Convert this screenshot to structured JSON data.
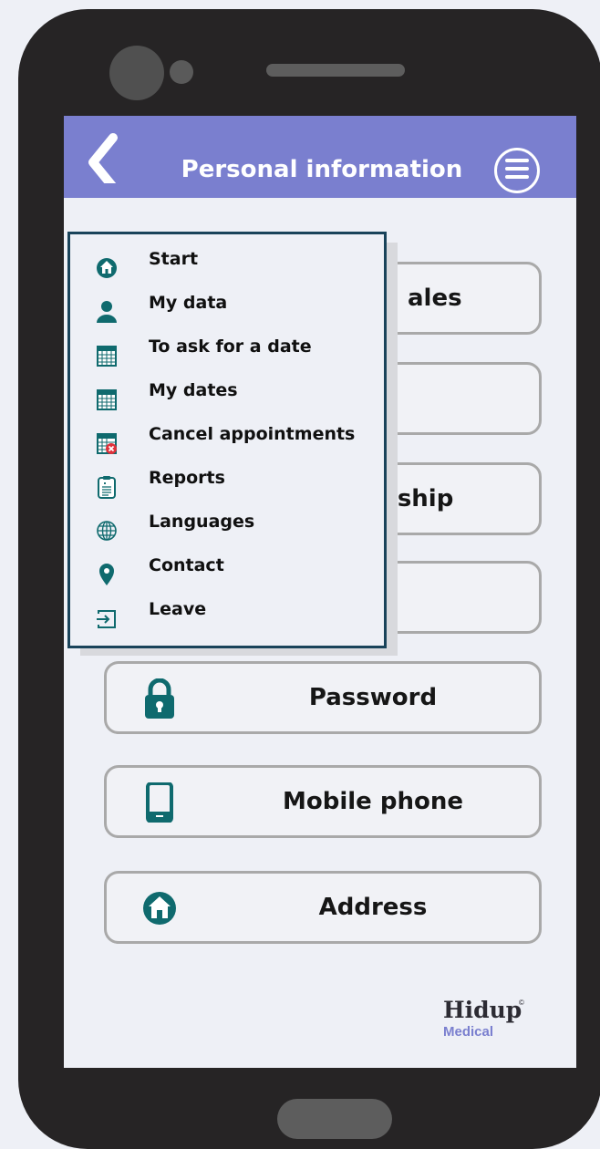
{
  "header": {
    "title": "Personal information",
    "back_icon": "chevron-left-icon",
    "menu_icon": "hamburger-menu-icon",
    "color": "#7a7fcf"
  },
  "options": [
    {
      "label": "ales",
      "icon": "none"
    },
    {
      "label": "",
      "icon": "none"
    },
    {
      "label": "rship",
      "icon": "none"
    },
    {
      "label": "",
      "icon": "none"
    },
    {
      "label": "Password",
      "icon": "lock-icon"
    },
    {
      "label": "Mobile phone",
      "icon": "mobile-phone-icon"
    },
    {
      "label": "Address",
      "icon": "home-icon"
    }
  ],
  "menu": {
    "items": [
      {
        "label": "Start",
        "icon": "home-icon"
      },
      {
        "label": "My data",
        "icon": "user-icon"
      },
      {
        "label": "To ask for a date",
        "icon": "calendar-icon"
      },
      {
        "label": "My dates",
        "icon": "calendar-icon"
      },
      {
        "label": "Cancel appointments",
        "icon": "calendar-cancel-icon"
      },
      {
        "label": "Reports",
        "icon": "clipboard-icon"
      },
      {
        "label": "Languages",
        "icon": "globe-icon"
      },
      {
        "label": "Contact",
        "icon": "location-pin-icon"
      },
      {
        "label": "Leave",
        "icon": "exit-icon"
      }
    ]
  },
  "logo": {
    "main": "Hidup",
    "sub": "Medical",
    "mark": "©"
  },
  "colors": {
    "accent": "#7a7fcf",
    "icon": "#0f6a6e",
    "menu_border": "#19435a"
  }
}
